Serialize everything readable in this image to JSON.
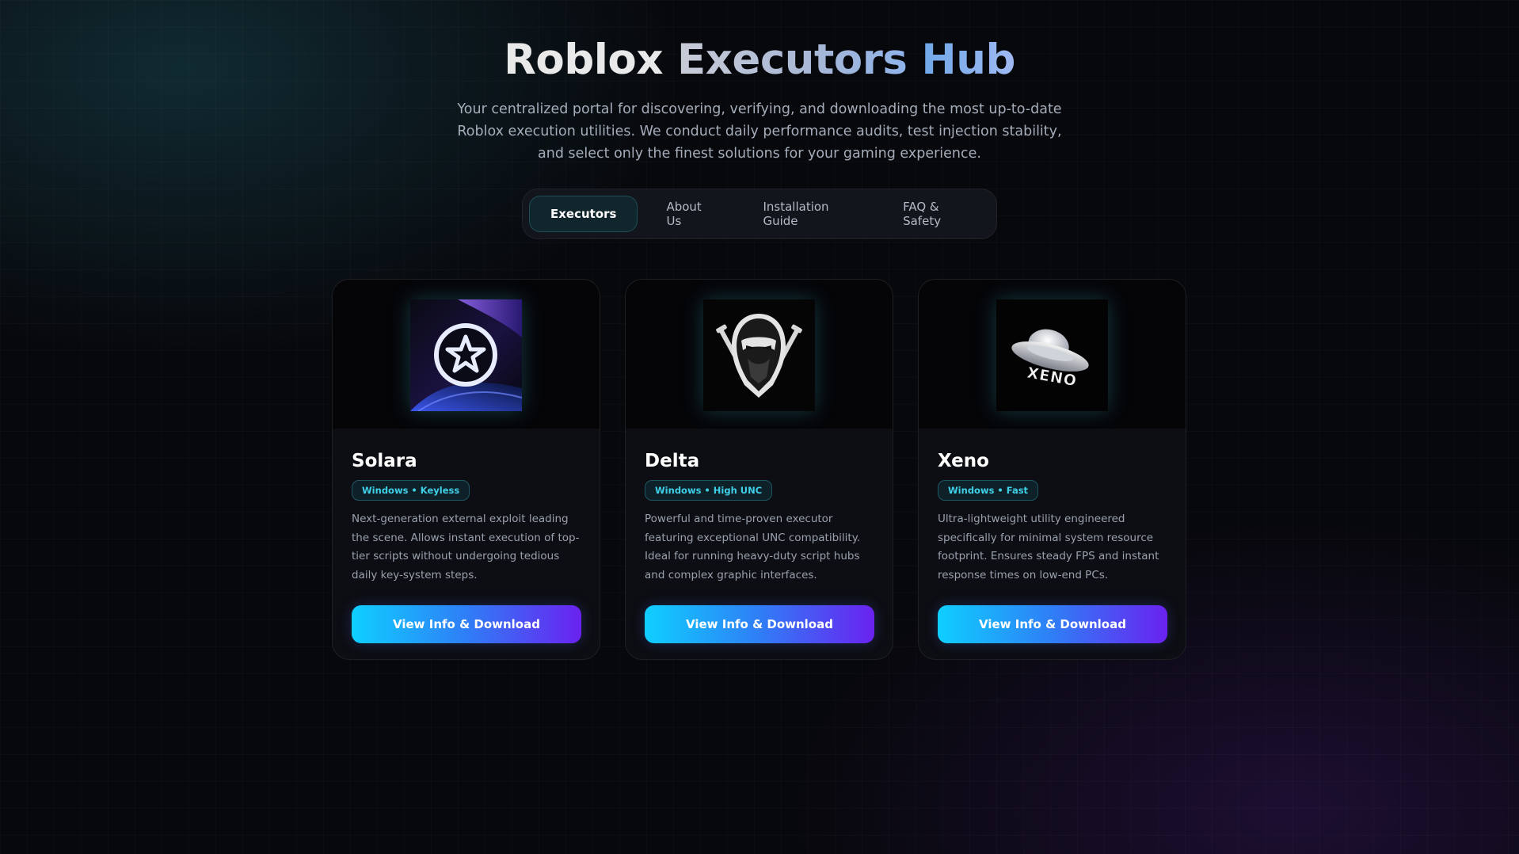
{
  "hero": {
    "title_part1": "Roblox",
    "title_part2": "Executors",
    "title_part3": "Hub",
    "description": "Your centralized portal for discovering, verifying, and downloading the most up-to-date Roblox execution utilities. We conduct daily performance audits, test injection stability, and select only the finest solutions for your gaming experience."
  },
  "tabs": [
    {
      "label": "Executors",
      "active": true
    },
    {
      "label": "About Us",
      "active": false
    },
    {
      "label": "Installation Guide",
      "active": false
    },
    {
      "label": "FAQ & Safety",
      "active": false
    }
  ],
  "cards": [
    {
      "name": "Solara",
      "badge": "Windows • Keyless",
      "description": "Next-generation external exploit leading the scene. Allows instant execution of top-tier scripts without undergoing tedious daily key-system steps.",
      "button_label": "View Info & Download",
      "logo_icon": "star-circle-icon"
    },
    {
      "name": "Delta",
      "badge": "Windows • High UNC",
      "description": "Powerful and time-proven executor featuring exceptional UNC compatibility. Ideal for running heavy-duty script hubs and complex graphic interfaces.",
      "button_label": "View Info & Download",
      "logo_icon": "ninja-icon"
    },
    {
      "name": "Xeno",
      "badge": "Windows • Fast",
      "description": "Ultra-lightweight utility engineered specifically for minimal system resource footprint. Ensures steady FPS and instant response times on low-end PCs.",
      "button_label": "View Info & Download",
      "logo_icon": "ufo-icon",
      "logo_text": "XENO"
    }
  ],
  "colors": {
    "accent_cyan": "#0fcfff",
    "accent_violet": "#6a22f0",
    "badge_text": "#3fd0e8",
    "background": "#07080c"
  }
}
